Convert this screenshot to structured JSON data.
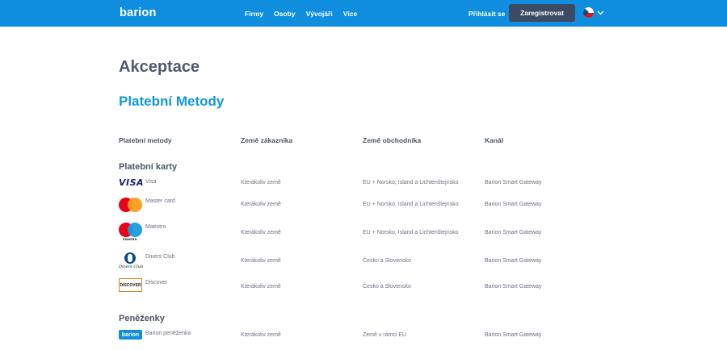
{
  "header": {
    "logo": "barion",
    "nav": [
      "Firmy",
      "Osoby",
      "Vývojáři",
      "Více"
    ],
    "login_label": "Přihlásit se",
    "register_label": "Zaregistrovat",
    "language_icon": "czech-flag-icon",
    "bg_color": "#0f8ee0"
  },
  "page": {
    "title": "Akceptace",
    "subtitle": "Platební Metody"
  },
  "table": {
    "headers": [
      "Platební metody",
      "Země zákazníka",
      "Země obchodníka",
      "Kanál"
    ],
    "sections": [
      {
        "title": "Platební karty",
        "rows": [
          {
            "icon": "visa-logo",
            "icon_text": "VISA",
            "name": "Visa",
            "customer": "Kterákoliv země",
            "merchant": "EU + Norsko, Island a Lichtenštejnsko",
            "channel": "Barion Smart Gateway"
          },
          {
            "icon": "mastercard-logo",
            "name": "Master card",
            "customer": "Kterákoliv země",
            "merchant": "EU + Norsko, Island a Lichtenštejnsko",
            "channel": "Barion Smart Gateway"
          },
          {
            "icon": "maestro-logo",
            "icon_text": "maestro",
            "name": "Maestro",
            "customer": "Kterákoliv země",
            "merchant": "EU + Norsko, Island a Lichtenštejnsko",
            "channel": "Barion Smart Gateway"
          },
          {
            "icon": "diners-club-logo",
            "icon_text": "Diners Club",
            "name": "Diners Club",
            "customer": "Kterákoliv země",
            "merchant": "Česko a Slovensko",
            "channel": "Barion Smart Gateway"
          },
          {
            "icon": "discover-logo",
            "icon_text": "DISCOVER",
            "name": "Discover",
            "customer": "Kterákoliv země",
            "merchant": "Česko a Slovensko",
            "channel": "Barion Smart Gateway"
          }
        ]
      },
      {
        "title": "Peněženky",
        "rows": [
          {
            "icon": "barion-logo",
            "icon_text": "barion",
            "name": "Barion peněženka",
            "customer": "Kterákoliv země",
            "merchant": "Země v rámci EU",
            "channel": "Barion Smart Gateway"
          }
        ]
      }
    ]
  }
}
